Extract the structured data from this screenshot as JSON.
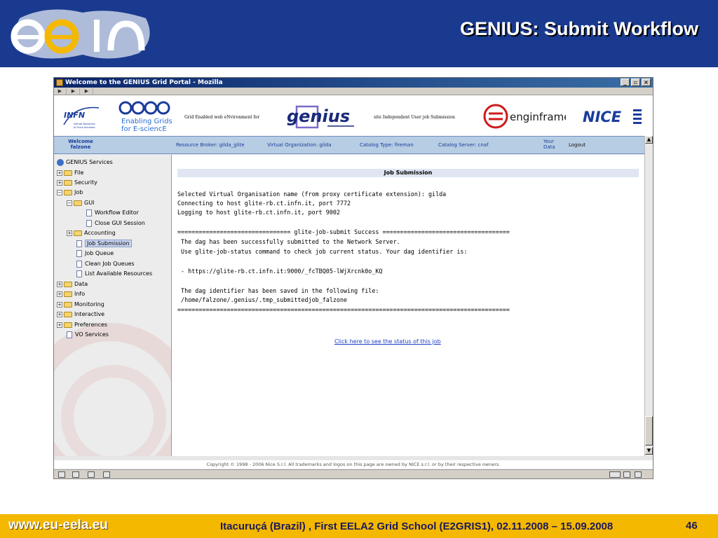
{
  "slide": {
    "title": "GENIUS: Submit Workflow",
    "footer_url": "www.eu-eela.eu",
    "footer_event": "Itacuruçá (Brazil) , First EELA2 Grid School (E2GRIS1), 02.11.2008 – 15.09.2008",
    "page_number": "46",
    "header_color": "#1a3a8f",
    "footer_color": "#f5b800"
  },
  "browser": {
    "window_title": "Welcome to the GENIUS Grid Portal - Mozilla",
    "minimize": "_",
    "maximize": "▫",
    "close": "×"
  },
  "banner": {
    "infn_name": "INFN",
    "infn_sub": "Istituto Nazionale di Fisica Nucleare",
    "egee_name": "eGee",
    "egee_tagline_1": "Enabling Grids",
    "egee_tagline_2": "for E-sciencE",
    "grid_env_text": "Grid Enabled web eNvironment for",
    "genius_name": "genius",
    "site_text": "site Independent User job Submission",
    "engineframe_name": "enginframe",
    "nice_name": "NICE"
  },
  "nav": {
    "welcome_1": "Welcome",
    "welcome_2": "falzone",
    "resource_broker": "Resource Broker: gilda_glite",
    "virtual_org": "Virtual Organization: gilda",
    "catalog_type": "Catalog Type: fireman",
    "catalog_server": "Catalog Server: cnaf",
    "your_data_1": "Your",
    "your_data_2": "Data",
    "logout": "Logout"
  },
  "tree": {
    "root": "GENIUS Services",
    "file": "File",
    "security": "Security",
    "job": "Job",
    "gui": "GUI",
    "workflow_editor": "Workflow Editor",
    "close_gui": "Close GUI Session",
    "accounting": "Accounting",
    "job_submission": "Job Submission",
    "job_queue": "Job Queue",
    "clean_job_queues": "Clean Job Queues",
    "list_resources": "List Available Resources",
    "data": "Data",
    "info": "Info",
    "monitoring": "Monitoring",
    "interactive": "Interactive",
    "preferences": "Preferences",
    "vo_services": "VO Services"
  },
  "content": {
    "header": "Job Submission",
    "line1": "Selected Virtual Organisation name (from proxy certificate extension): gilda",
    "line2": "Connecting to host glite-rb.ct.infn.it, port 7772",
    "line3": "Logging to host glite-rb.ct.infn.it, port 9002",
    "line4": "================================ glite-job-submit Success ====================================",
    "line5": " The dag has been successfully submitted to the Network Server.",
    "line6": " Use glite-job-status command to check job current status. Your dag identifier is:",
    "line7": " - https://glite-rb.ct.infn.it:9000/_fcTBQ05-lWjXrcnk0o_KQ",
    "line8": " The dag identifier has been saved in the following file:",
    "line9": " /home/falzone/.genius/.tmp_submittedjob_falzone",
    "line10": "==============================================================================================",
    "status_link": "Click here to see the status of this job"
  },
  "copyright": "Copyright © 1998 - 2006 Nice S.r.l. All trademarks and logos on this page are owned by NICE s.r.l. or by their respective owners."
}
